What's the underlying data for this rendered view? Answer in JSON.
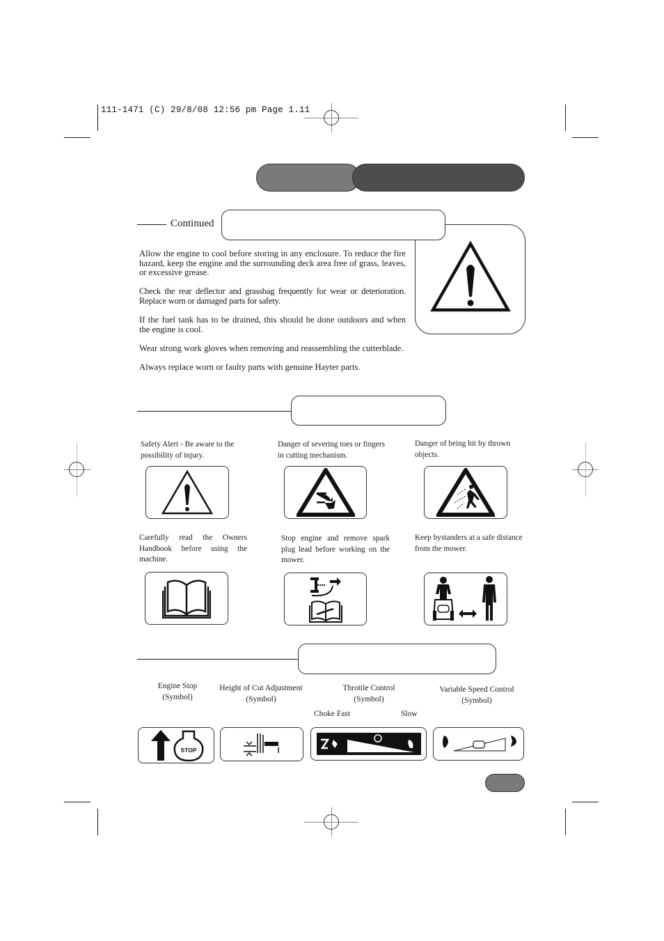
{
  "print_slug": "111-1471 (C)  29/8/08  12:56 pm  Page 1.11",
  "header_tabs": {
    "left_tab": "",
    "right_tab": ""
  },
  "section1": {
    "lead_label": "Continued",
    "title": "",
    "paragraphs": [
      "Allow the engine to cool before storing in any enclosure. To reduce the fire hazard, keep the engine and the surrounding deck area free of grass, leaves, or excessive grease.",
      "Check the rear deflector and grassbag frequently for wear or deterioration. Replace worn or damaged parts for safety.",
      "If the fuel tank has to be drained, this should be done outdoors and when the engine is cool.",
      "Wear strong work gloves when removing and reassembling the cutterblade.",
      "Always replace worn or faulty parts with genuine Hayter parts."
    ],
    "panel_icon": "warning-triangle-icon"
  },
  "section2": {
    "title": "",
    "symbols": [
      {
        "caption": "Safety Alert - Be aware to the possibility of injury.",
        "icon": "safety-alert-icon"
      },
      {
        "caption": "Danger of severing toes or fingers in cutting mechanism.",
        "icon": "severing-hazard-icon"
      },
      {
        "caption": "Danger of being hit by thrown objects.",
        "icon": "thrown-objects-icon"
      },
      {
        "caption": "Carefully read the Owners Handbook before using the machine.",
        "icon": "read-handbook-icon"
      },
      {
        "caption": "Stop engine and remove spark plug lead before working on the mower.",
        "icon": "spark-plug-icon"
      },
      {
        "caption": "Keep bystanders at a safe distance from the mower.",
        "icon": "bystanders-icon"
      }
    ]
  },
  "section3": {
    "title": "",
    "controls": [
      {
        "label": "Engine Stop",
        "sub": "(Symbol)",
        "icon": "engine-stop-icon",
        "icon_text": "STOP"
      },
      {
        "label": "Height of Cut Adjustment",
        "sub": "(Symbol)",
        "icon": "height-of-cut-icon"
      },
      {
        "label": "Throttle Control",
        "sub": "(Symbol)",
        "icon": "throttle-control-icon"
      },
      {
        "label": "Variable Speed Control",
        "sub": "(Symbol)",
        "icon": "variable-speed-icon"
      }
    ],
    "throttle_labels": {
      "choke_fast": "Choke Fast",
      "slow": "Slow"
    }
  },
  "page_number": ""
}
